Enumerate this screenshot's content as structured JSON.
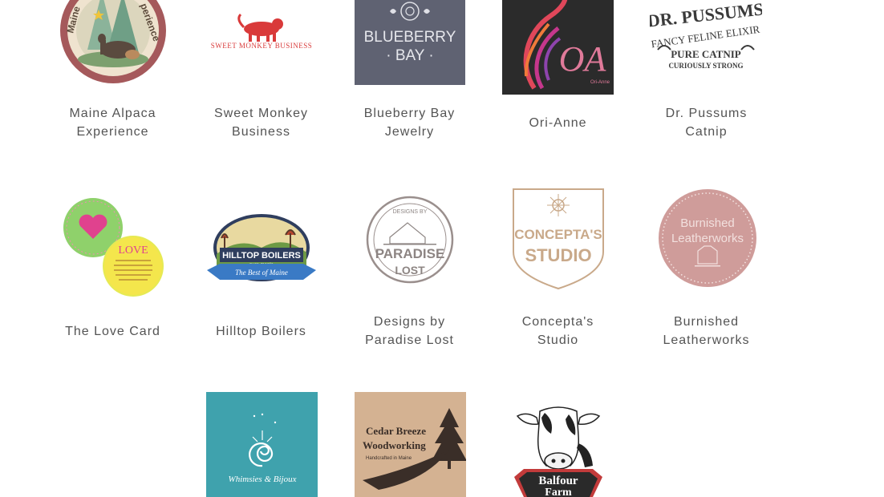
{
  "vendors": [
    {
      "lines": [
        "Maine Alpaca",
        "Experience"
      ],
      "logo": {
        "top": "Maine",
        "right": "perience"
      }
    },
    {
      "lines": [
        "Sweet Monkey",
        "Business"
      ],
      "logo": {
        "text": "SWEET MONKEY BUSINESS"
      }
    },
    {
      "lines": [
        "Blueberry Bay",
        "Jewelry"
      ],
      "logo": {
        "l1": "BLUEBERRY",
        "l2": "· BAY ·"
      }
    },
    {
      "lines": [
        "Ori-Anne"
      ],
      "logo": {
        "mark": "OA",
        "small": "Ori-Anne"
      }
    },
    {
      "lines": [
        "Dr. Pussums",
        "Catnip"
      ],
      "logo": {
        "l1": "DR. PUSSUMS",
        "l2": "FANCY FELINE ELIXIR",
        "l3": "PURE CATNIP",
        "l4": "CURIOUSLY STRONG"
      }
    },
    {
      "lines": [
        "The Love Card"
      ],
      "logo": {
        "text": "LOVE"
      }
    },
    {
      "lines": [
        "Hilltop Boilers"
      ],
      "logo": {
        "l1": "HILLTOP BOILERS",
        "l2": "pure maple",
        "l3": "The Best of Maine"
      }
    },
    {
      "lines": [
        "Designs by",
        "Paradise Lost"
      ],
      "logo": {
        "l1": "DESIGNS BY",
        "l2": "PARADISE",
        "l3": "LOST"
      }
    },
    {
      "lines": [
        "Concepta's",
        "Studio"
      ],
      "logo": {
        "l1": "CONCEPTA'S",
        "l2": "STUDIO"
      }
    },
    {
      "lines": [
        "Burnished",
        "Leatherworks"
      ],
      "logo": {
        "l1": "Burnished",
        "l2": "Leatherworks"
      }
    },
    {
      "lines": [],
      "logo": {
        "text": "Whimsies & Bijoux"
      }
    },
    {
      "lines": [],
      "logo": {
        "l1": "Cedar Breeze",
        "l2": "Woodworking",
        "l3": "Handcrafted in Maine"
      }
    },
    {
      "lines": [],
      "logo": {
        "l1": "Balfour",
        "l2": "Farm"
      }
    }
  ],
  "colors": {
    "label": "#545454",
    "blueberry_bg": "#5f6272",
    "orianne_bg": "#2b2b2b",
    "whimsies_bg": "#3fa2ad",
    "cedar_bg": "#d9b99a",
    "burnished_pink": "#cf9c9a",
    "concepta_tan": "#c9a98a",
    "monkey_red": "#d93a3a"
  }
}
